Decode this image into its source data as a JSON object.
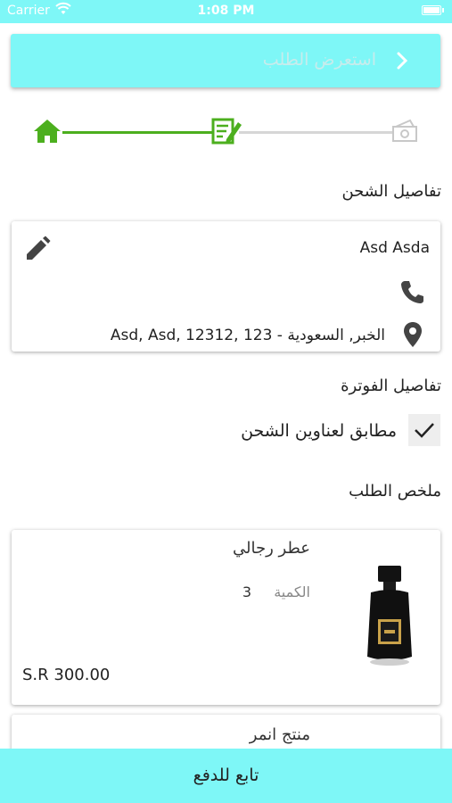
{
  "status_bar": {
    "carrier": "Carrier",
    "time": "1:08 PM"
  },
  "header": {
    "title": "استعرض الطلب"
  },
  "stepper": {
    "steps": [
      "home-icon",
      "edit-note-icon",
      "money-icon"
    ],
    "active_color": "#4caf1e",
    "inactive_color": "#d6d6d6"
  },
  "shipping": {
    "section_title": "تفاصيل الشحن",
    "name": "Asd Asda",
    "address": "الخبر, السعودية - 123 ,Asd, Asd, 12312"
  },
  "billing": {
    "section_title": "تفاصيل الفوترة",
    "same_as_shipping_label": "مطابق لعناوين الشحن",
    "same_as_shipping_checked": true
  },
  "summary": {
    "section_title": "ملخص الطلب",
    "items": [
      {
        "name": "عطر رجالي",
        "qty_label": "الكمية",
        "qty": "3",
        "price": "S.R 300.00"
      },
      {
        "name": "منتج انمر"
      }
    ]
  },
  "footer": {
    "pay_button_label": "تابع للدفع"
  },
  "colors": {
    "accent": "#7ef7f7",
    "progress": "#4caf1e"
  }
}
